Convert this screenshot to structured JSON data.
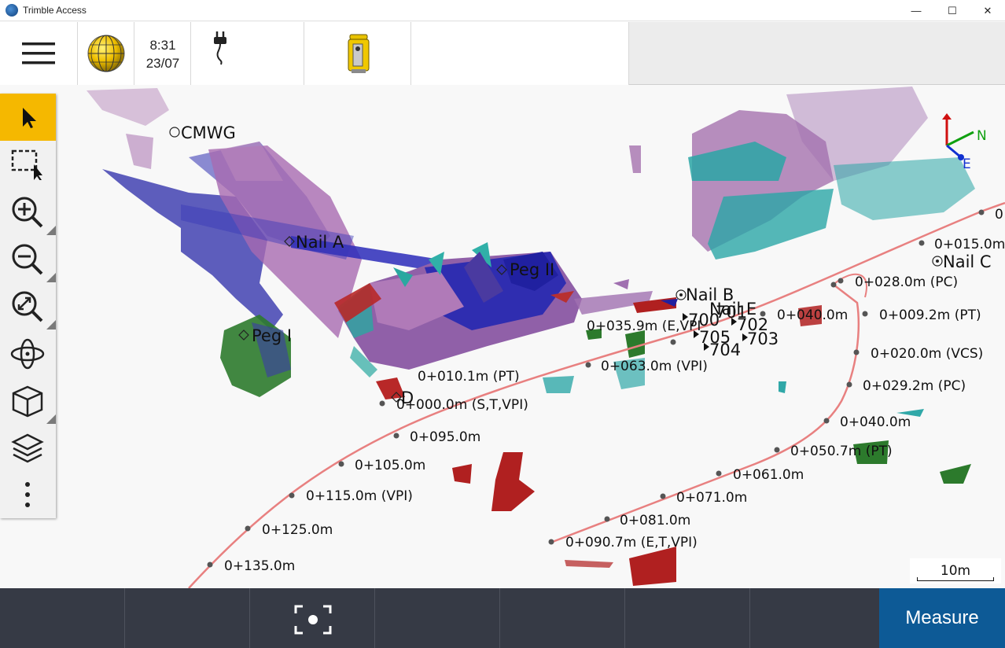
{
  "window": {
    "title": "Trimble Access",
    "minimize": "—",
    "maximize": "☐",
    "close": "✕"
  },
  "status": {
    "time": "8:31",
    "date": "23/07",
    "icons": [
      "menu-icon",
      "globe-icon",
      "power-plug-icon",
      "total-station-icon"
    ]
  },
  "toolbar": {
    "tools": [
      "select-icon",
      "box-select-icon",
      "zoom-in-icon",
      "zoom-out-icon",
      "zoom-extents-icon",
      "orbit-icon",
      "view-cube-icon",
      "layers-icon",
      "more-icon"
    ]
  },
  "map": {
    "points": {
      "cmwg": "CMWG",
      "nail_a": "Nail A",
      "peg_ii": "Peg II",
      "peg_i": "Peg I",
      "nail_b": "Nail B",
      "nail_c": "Nail C",
      "nail_e": "Nail E",
      "d": "D",
      "p700": "700",
      "p701": "701",
      "p702": "702",
      "p703": "703",
      "p704": "704",
      "p705": "705"
    },
    "stations": {
      "s0": "0",
      "s015": "0+015.0m",
      "s028": "0+028.0m (PC)",
      "s009": "0+009.2m (PT)",
      "s040a": "0+040.0m",
      "s0359": "0+035.9m (E,VPI",
      "s020": "0+020.0m (VCS)",
      "s063": "0+063.0m (VPI)",
      "s010": "0+010.1m (PT)",
      "s029": "0+029.2m (PC)",
      "s000": "0+000.0m (S,T,VPI)",
      "s040b": "0+040.0m",
      "s095": "0+095.0m",
      "s0507": "0+050.7m (PT)",
      "s105": "0+105.0m",
      "s061": "0+061.0m",
      "s115": "0+115.0m (VPI)",
      "s071": "0+071.0m",
      "s081": "0+081.0m",
      "s125": "0+125.0m",
      "s0907": "0+090.7m (E,T,VPI)",
      "s135": "0+135.0m"
    },
    "axes": {
      "n": "N",
      "e": "E"
    },
    "scale": "10m"
  },
  "bottom": {
    "snap_icon": "camera-target-icon",
    "measure": "Measure"
  }
}
